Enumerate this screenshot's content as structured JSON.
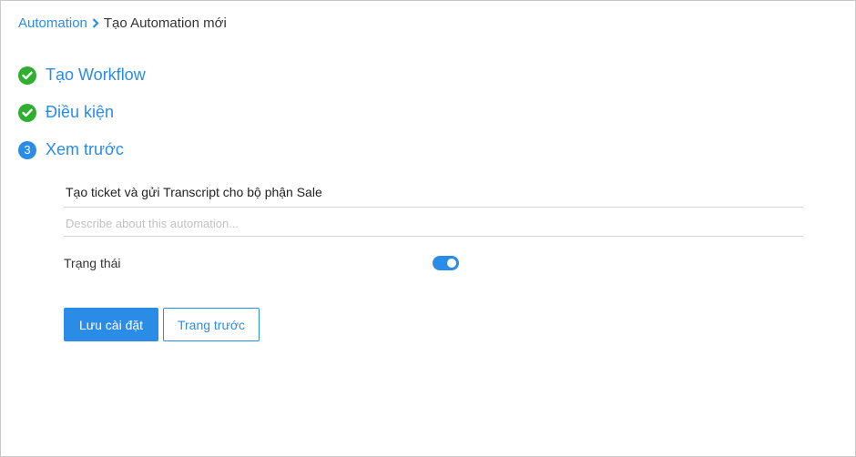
{
  "breadcrumb": {
    "parent": "Automation",
    "current": "Tạo Automation mới"
  },
  "steps": [
    {
      "label": "Tạo Workflow",
      "state": "done"
    },
    {
      "label": "Điều kiện",
      "state": "done"
    },
    {
      "label": "Xem trước",
      "state": "active",
      "number": "3"
    }
  ],
  "form": {
    "name_value": "Tạo ticket và gửi Transcript cho bộ phận Sale",
    "description_placeholder": "Describe about this automation...",
    "status_label": "Trạng thái",
    "status_enabled": true
  },
  "buttons": {
    "save": "Lưu cài đặt",
    "previous": "Trang trước"
  },
  "colors": {
    "accent": "#2b8ce8",
    "success": "#2fae2f"
  }
}
